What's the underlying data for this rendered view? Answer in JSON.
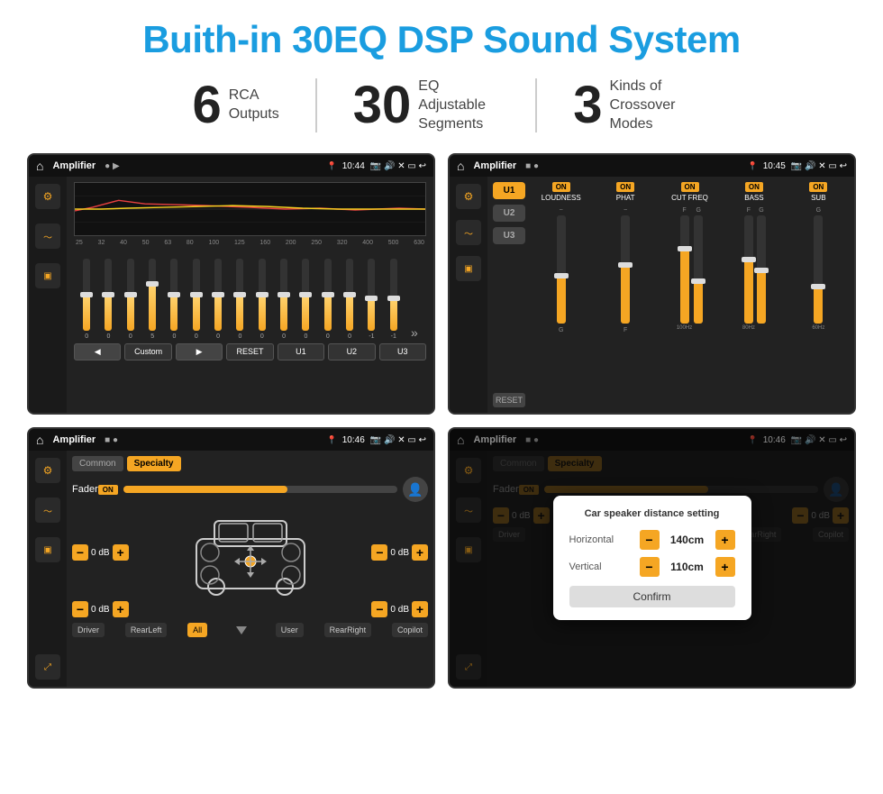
{
  "title": "Buith-in 30EQ DSP Sound System",
  "stats": [
    {
      "number": "6",
      "label": "RCA\nOutputs"
    },
    {
      "number": "30",
      "label": "EQ Adjustable\nSegments"
    },
    {
      "number": "3",
      "label": "Kinds of\nCrossover Modes"
    }
  ],
  "screen1": {
    "title": "Amplifier",
    "time": "10:44",
    "freqs": [
      "25",
      "32",
      "40",
      "50",
      "63",
      "80",
      "100",
      "125",
      "160",
      "200",
      "250",
      "320",
      "400",
      "500",
      "630"
    ],
    "sliderVals": [
      "0",
      "0",
      "0",
      "5",
      "0",
      "0",
      "0",
      "0",
      "0",
      "0",
      "0",
      "0",
      "0",
      "-1",
      "0",
      "-1"
    ],
    "controls": [
      "◀",
      "Custom",
      "▶",
      "RESET",
      "U1",
      "U2",
      "U3"
    ]
  },
  "screen2": {
    "title": "Amplifier",
    "time": "10:45",
    "presets": [
      "U1",
      "U2",
      "U3"
    ],
    "channels": [
      {
        "on": true,
        "name": "LOUDNESS"
      },
      {
        "on": true,
        "name": "PHAT"
      },
      {
        "on": true,
        "name": "CUT FREQ"
      },
      {
        "on": true,
        "name": "BASS"
      },
      {
        "on": true,
        "name": "SUB"
      }
    ],
    "reset": "RESET"
  },
  "screen3": {
    "title": "Amplifier",
    "time": "10:46",
    "tabs": [
      "Common",
      "Specialty"
    ],
    "activeTab": "Specialty",
    "fader": "Fader",
    "faderOn": "ON",
    "zones": {
      "topLeft": "0 dB",
      "topRight": "0 dB",
      "bottomLeft": "0 dB",
      "bottomRight": "0 dB"
    },
    "buttons": [
      "Driver",
      "RearLeft",
      "All",
      "User",
      "RearRight",
      "Copilot"
    ]
  },
  "screen4": {
    "title": "Amplifier",
    "time": "10:46",
    "tabs": [
      "Common",
      "Specialty"
    ],
    "dialog": {
      "title": "Car speaker distance setting",
      "horizontal_label": "Horizontal",
      "horizontal_val": "140cm",
      "vertical_label": "Vertical",
      "vertical_val": "110cm",
      "confirm": "Confirm"
    },
    "zones": {
      "topRight": "0 dB",
      "bottomRight": "0 dB"
    }
  }
}
